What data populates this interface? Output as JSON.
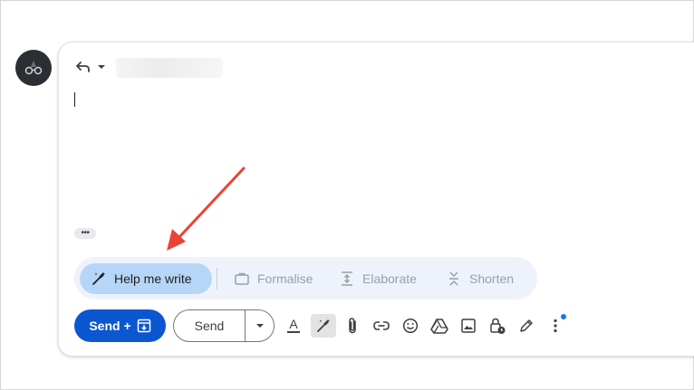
{
  "compose": {
    "help_me_write": "Help me write",
    "formalise": "Formalise",
    "elaborate": "Elaborate",
    "shorten": "Shorten",
    "ellipsis": "•••"
  },
  "footer": {
    "send_plus_label": "Send +",
    "send_label": "Send"
  },
  "icons": {
    "reply": "reply-icon",
    "dropdown": "chevron-down-icon",
    "pencil_sparkle": "pencil-sparkle-icon",
    "formatting": "text-formatting-icon",
    "attach": "paperclip-icon",
    "link": "link-icon",
    "emoji": "emoji-icon",
    "drive": "drive-icon",
    "photo": "image-icon",
    "confidential": "lock-clock-icon",
    "signature": "signature-pen-icon",
    "more": "more-vert-icon"
  },
  "colors": {
    "primary": "#0b57d0",
    "help_bg": "#b6d6f7",
    "ai_bar_bg": "#eef2fa",
    "annotation_arrow": "#ea4335",
    "notification_dot": "#1a73e8"
  }
}
